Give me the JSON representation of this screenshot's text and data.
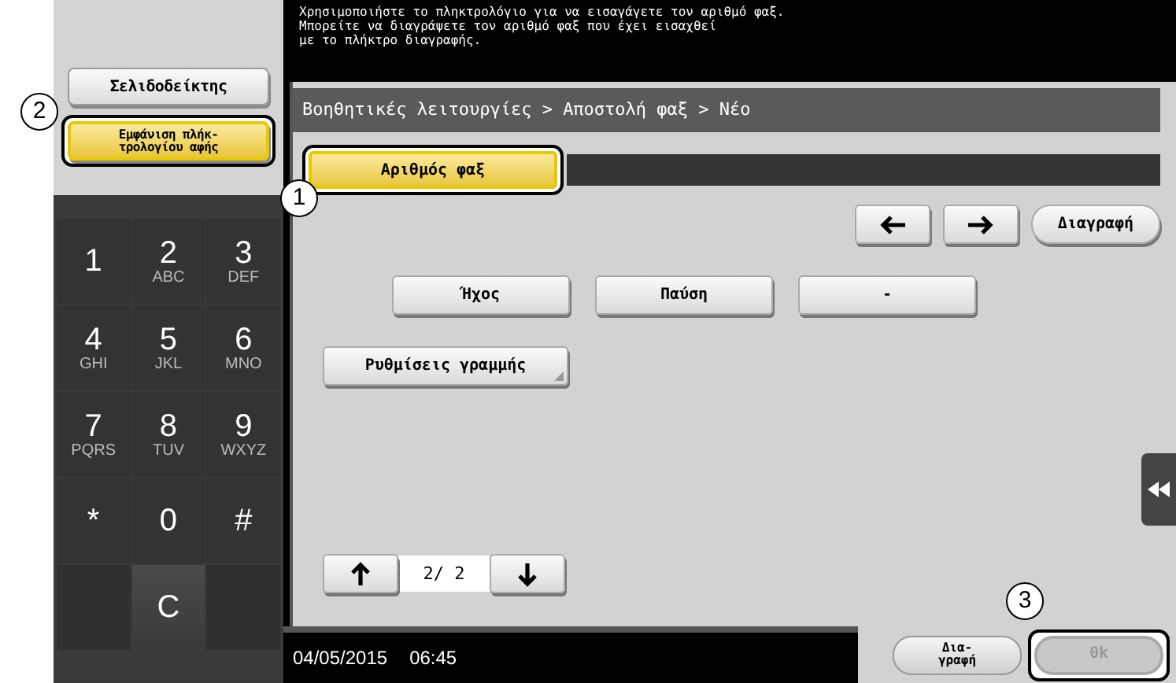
{
  "message": {
    "lines": [
      "Χρησιμοποιήστε το πληκτρολόγιο για να εισαγάγετε τον αριθμό φαξ.",
      "Μπορείτε να διαγράψετε τον αριθμό φαξ που έχει εισαχθεί",
      "με το πλήκτρο διαγραφής."
    ]
  },
  "left_buttons": [
    {
      "label": "Σελιδοδείκτης",
      "selected": false,
      "highlighted": false
    },
    {
      "label": "Εμφάνιση πλήκ-\nτρολογίου αφής",
      "selected": true,
      "highlighted": true,
      "callout": "2"
    }
  ],
  "keypad": [
    {
      "kind": "key",
      "digit": "1"
    },
    {
      "kind": "key",
      "digit": "2",
      "letters": "ABC"
    },
    {
      "kind": "key",
      "digit": "3",
      "letters": "DEF"
    },
    {
      "kind": "key",
      "digit": "4",
      "letters": "GHI"
    },
    {
      "kind": "key",
      "digit": "5",
      "letters": "JKL"
    },
    {
      "kind": "key",
      "digit": "6",
      "letters": "MNO"
    },
    {
      "kind": "key",
      "digit": "7",
      "letters": "PQRS"
    },
    {
      "kind": "key",
      "digit": "8",
      "letters": "TUV"
    },
    {
      "kind": "key",
      "digit": "9",
      "letters": "WXYZ"
    },
    {
      "kind": "key",
      "digit": "*"
    },
    {
      "kind": "key",
      "digit": "0"
    },
    {
      "kind": "key",
      "digit": "#"
    },
    {
      "kind": "blank"
    },
    {
      "kind": "clear",
      "digit": "C"
    },
    {
      "kind": "blank"
    }
  ],
  "breadcrumb": "Βοηθητικές λειτουργίες > Αποστολή φαξ > Νέο",
  "fax_field": {
    "label": "Αριθμός φαξ",
    "selected": true,
    "highlighted": true,
    "callout": "1"
  },
  "cursor_buttons": [
    {
      "kind": "left"
    },
    {
      "kind": "right"
    }
  ],
  "delete_button": "Διαγραφή",
  "symbol_buttons": [
    "Ήχος",
    "Παύση",
    "-"
  ],
  "line_settings_button": "Ρυθμίσεις γραμμής",
  "pager": {
    "text": "2/ 2"
  },
  "status_bar": {
    "date": "04/05/2015",
    "time": "06:45"
  },
  "bottom_buttons": [
    {
      "label": "Δια-\nγραφή",
      "disabled": false,
      "highlighted": false
    },
    {
      "label": "0k",
      "disabled": true,
      "highlighted": true,
      "callout": "3"
    }
  ]
}
